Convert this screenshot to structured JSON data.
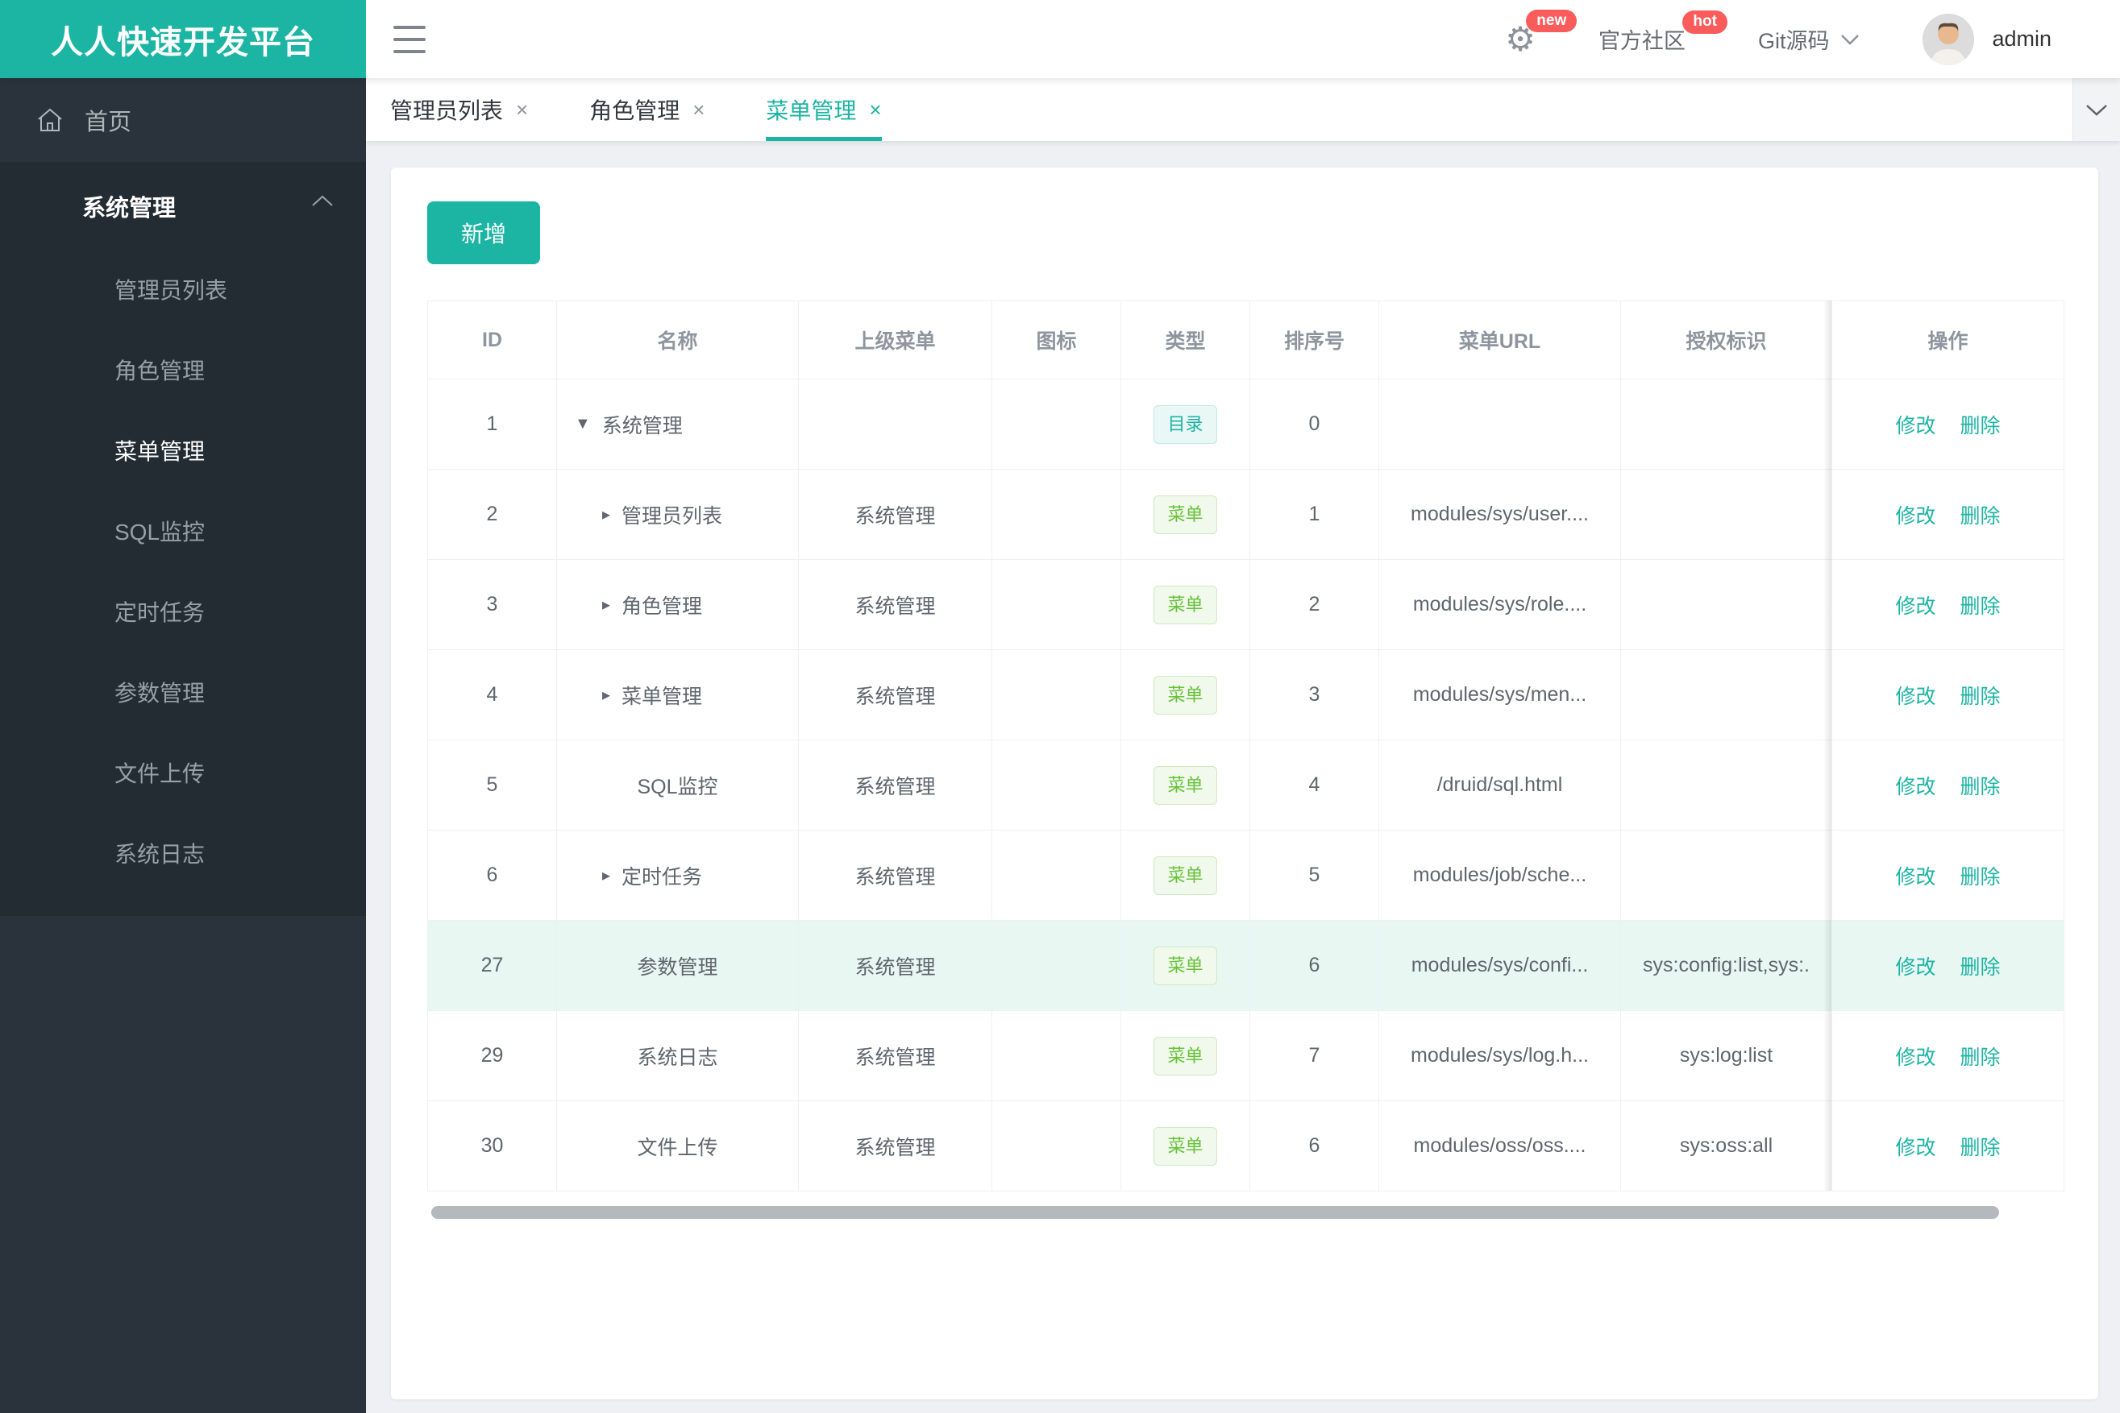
{
  "app": {
    "title": "人人快速开发平台"
  },
  "header": {
    "new_badge": "new",
    "hot_badge": "hot",
    "community_label": "官方社区",
    "git_label": "Git源码",
    "username": "admin"
  },
  "sidebar": {
    "home_label": "首页",
    "group_label": "系统管理",
    "items": [
      {
        "label": "管理员列表",
        "active": false
      },
      {
        "label": "角色管理",
        "active": false
      },
      {
        "label": "菜单管理",
        "active": true
      },
      {
        "label": "SQL监控",
        "active": false
      },
      {
        "label": "定时任务",
        "active": false
      },
      {
        "label": "参数管理",
        "active": false
      },
      {
        "label": "文件上传",
        "active": false
      },
      {
        "label": "系统日志",
        "active": false
      }
    ]
  },
  "tabs": [
    {
      "label": "管理员列表",
      "active": false
    },
    {
      "label": "角色管理",
      "active": false
    },
    {
      "label": "菜单管理",
      "active": true
    }
  ],
  "toolbar": {
    "add_label": "新增"
  },
  "table": {
    "columns": [
      "ID",
      "名称",
      "上级菜单",
      "图标",
      "类型",
      "排序号",
      "菜单URL",
      "授权标识",
      "操作"
    ],
    "action_labels": [
      "修改",
      "删除"
    ],
    "rows": [
      {
        "id": "1",
        "name": "系统管理",
        "caret": "caret-down-icon",
        "indent": 0,
        "parent": "",
        "icon": "",
        "type": "目录",
        "type_key": "dir",
        "order": "0",
        "url": "",
        "perm": "",
        "highlighted": false
      },
      {
        "id": "2",
        "name": "管理员列表",
        "caret": "caret-right-icon",
        "indent": 1,
        "parent": "系统管理",
        "icon": "",
        "type": "菜单",
        "type_key": "menu",
        "order": "1",
        "url": "modules/sys/user....",
        "perm": "",
        "highlighted": false
      },
      {
        "id": "3",
        "name": "角色管理",
        "caret": "caret-right-icon",
        "indent": 1,
        "parent": "系统管理",
        "icon": "",
        "type": "菜单",
        "type_key": "menu",
        "order": "2",
        "url": "modules/sys/role....",
        "perm": "",
        "highlighted": false
      },
      {
        "id": "4",
        "name": "菜单管理",
        "caret": "caret-right-icon",
        "indent": 1,
        "parent": "系统管理",
        "icon": "",
        "type": "菜单",
        "type_key": "menu",
        "order": "3",
        "url": "modules/sys/men...",
        "perm": "",
        "highlighted": false
      },
      {
        "id": "5",
        "name": "SQL监控",
        "caret": null,
        "indent": 1,
        "parent": "系统管理",
        "icon": "",
        "type": "菜单",
        "type_key": "menu",
        "order": "4",
        "url": "/druid/sql.html",
        "perm": "",
        "highlighted": false
      },
      {
        "id": "6",
        "name": "定时任务",
        "caret": "caret-right-icon",
        "indent": 1,
        "parent": "系统管理",
        "icon": "",
        "type": "菜单",
        "type_key": "menu",
        "order": "5",
        "url": "modules/job/sche...",
        "perm": "",
        "highlighted": false
      },
      {
        "id": "27",
        "name": "参数管理",
        "caret": null,
        "indent": 1,
        "parent": "系统管理",
        "icon": "",
        "type": "菜单",
        "type_key": "menu",
        "order": "6",
        "url": "modules/sys/confi...",
        "perm": "sys:config:list,sys:.",
        "highlighted": true
      },
      {
        "id": "29",
        "name": "系统日志",
        "caret": null,
        "indent": 1,
        "parent": "系统管理",
        "icon": "",
        "type": "菜单",
        "type_key": "menu",
        "order": "7",
        "url": "modules/sys/log.h...",
        "perm": "sys:log:list",
        "highlighted": false
      },
      {
        "id": "30",
        "name": "文件上传",
        "caret": null,
        "indent": 1,
        "parent": "系统管理",
        "icon": "",
        "type": "菜单",
        "type_key": "menu",
        "order": "6",
        "url": "modules/oss/oss....",
        "perm": "sys:oss:all",
        "highlighted": false
      }
    ]
  },
  "colors": {
    "accent": "#1cb4a3",
    "badge_red": "#fa5c5c",
    "tag_dir_text": "#1db3a2",
    "tag_menu_text": "#67c23a",
    "row_highlight": "#e9f7f3",
    "sidebar_bg": "#2a333b",
    "sidebar_group_bg": "#232c33"
  }
}
